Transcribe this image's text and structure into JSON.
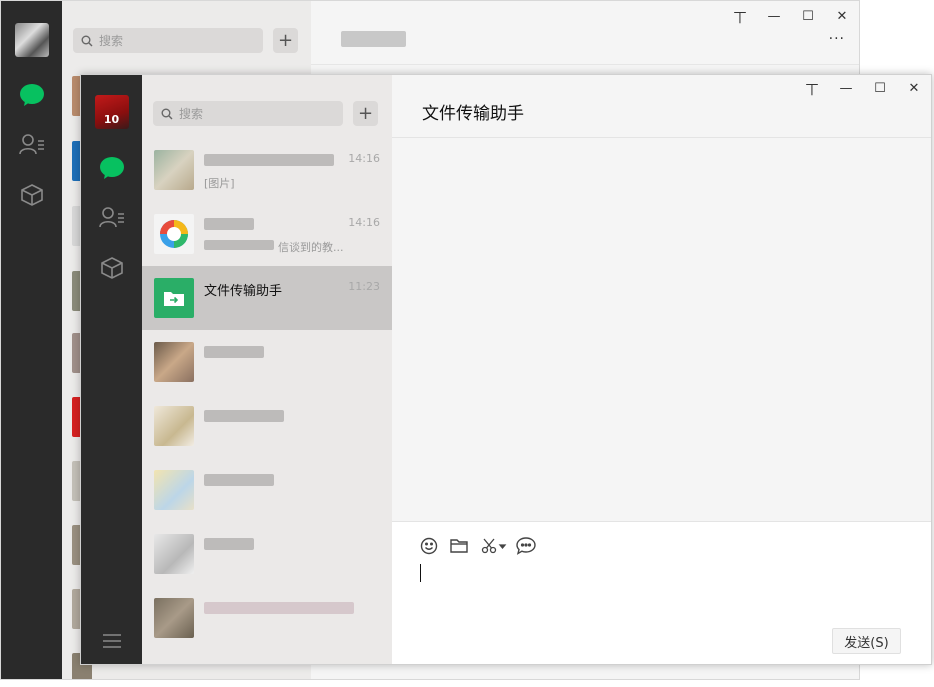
{
  "back_window": {
    "search_placeholder": "搜索",
    "plus": "+",
    "window_controls": {
      "pin": "丅",
      "minimize": "—",
      "maximize": "☐",
      "close": "✕"
    },
    "more": "···"
  },
  "front_window": {
    "search_placeholder": "搜索",
    "plus": "+",
    "window_controls": {
      "pin": "丅",
      "minimize": "—",
      "maximize": "☐",
      "close": "✕"
    },
    "chat_title": "文件传输助手",
    "chats": [
      {
        "name": "",
        "time": "14:16",
        "preview": "[图片]"
      },
      {
        "name": "",
        "time": "14:16",
        "preview": "信谈到的教..."
      },
      {
        "name": "文件传输助手",
        "time": "11:23",
        "preview": ""
      },
      {
        "name": "",
        "time": "",
        "preview": ""
      },
      {
        "name": "",
        "time": "",
        "preview": ""
      },
      {
        "name": "",
        "time": "",
        "preview": ""
      },
      {
        "name": "",
        "time": "",
        "preview": ""
      },
      {
        "name": "",
        "time": "",
        "preview": ""
      }
    ],
    "toolbar_icons": [
      "emoji-icon",
      "folder-icon",
      "scissors-icon",
      "chat-bubble-icon"
    ],
    "send_label": "发送(S)"
  },
  "colors": {
    "wechat_green": "#07c160",
    "file_helper_green": "#2aae67",
    "rail": "#2b2b2b"
  }
}
